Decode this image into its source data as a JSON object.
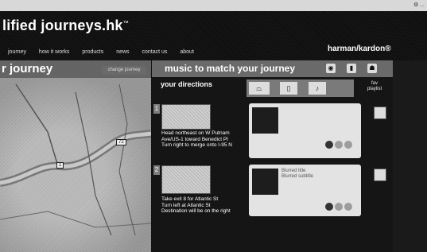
{
  "site": {
    "logo": "lified journeys.hk",
    "logo_mark": "™",
    "brand": "harman/kardon®"
  },
  "nav": [
    "journey",
    "how it works",
    "products",
    "news",
    "contact us",
    "about"
  ],
  "map": {
    "title": "r journey",
    "change_button": "change journey",
    "signs": [
      "1",
      "72"
    ]
  },
  "music": {
    "title": "music to match your journey",
    "directions_label": "your directions",
    "fav_label": "fav\nplaylist",
    "steps": [
      {
        "number": "1",
        "directions": [
          "Head northeast on W Putnam",
          "Ave/US-1 toward Benedict Pl",
          "Turn right to merge onto I-95 N"
        ],
        "song_text": ""
      },
      {
        "number": "2",
        "directions": [
          "Take exit 8 for Atlantic St",
          "Turn left at Atlantic St",
          "Destination will be on the right"
        ],
        "song_text": "Blurred title\nBlurred subtitle"
      }
    ]
  }
}
